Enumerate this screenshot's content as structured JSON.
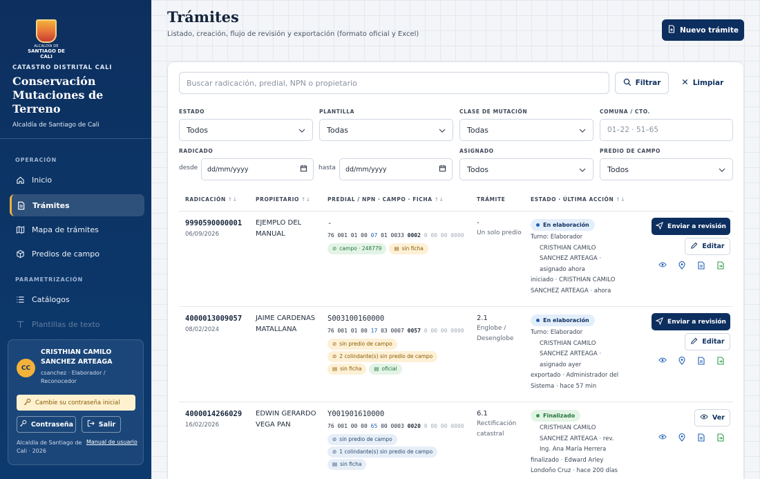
{
  "sidebar": {
    "logo_sub": "ALCALDÍA DE",
    "logo_main": "SANTIAGO DE CALI",
    "kicker": "CATASTRO DISTRITAL CALI",
    "title": "Conservación Mutaciones de Terreno",
    "subtitle": "Alcaldía de Santiago de Cali",
    "section_operacion": "OPERACIÓN",
    "section_param": "PARAMETRIZACIÓN",
    "nav": {
      "inicio": "Inicio",
      "tramites": "Trámites",
      "mapa": "Mapa de trámites",
      "predios": "Predios de campo",
      "catalogos": "Catálogos",
      "plantillas": "Plantillas de texto"
    },
    "user": {
      "initials": "CC",
      "name": "CRISTHIAN CAMILO SANCHEZ ARTEAGA",
      "role": "csanchez · Elaborador / Reconocedor",
      "warn": "Cambie su contraseña inicial",
      "password_btn": "Contraseña",
      "logout_btn": "Salir",
      "footer": "Alcaldía de Santiago de Cali · 2026",
      "manual": "Manual de usuario"
    }
  },
  "header": {
    "title": "Trámites",
    "subtitle": "Listado, creación, flujo de revisión y exportación (formato oficial y Excel)",
    "new_button": "Nuevo trámite"
  },
  "filters": {
    "search_placeholder": "Buscar radicación, predial, NPN o propietario",
    "filter_btn": "Filtrar",
    "clear_btn": "Limpiar",
    "estado_label": "ESTADO",
    "estado_value": "Todos",
    "plantilla_label": "PLANTILLA",
    "plantilla_value": "Todas",
    "clase_label": "CLASE DE MUTACIÓN",
    "clase_value": "Todas",
    "comuna_label": "COMUNA / CTO.",
    "comuna_placeholder": "01–22 · 51–65",
    "radicado_label": "RADICADO",
    "desde": "desde",
    "hasta": "hasta",
    "date_placeholder": "dd/mm/yyyy",
    "asignado_label": "ASIGNADO",
    "asignado_value": "Todos",
    "predio_label": "PREDIO DE CAMPO",
    "predio_value": "Todos"
  },
  "table": {
    "headers": {
      "radicacion": "RADICACIÓN",
      "propietario": "PROPIETARIO",
      "predial": "PREDIAL / NPN · CAMPO · FICHA",
      "tramite": "TRÁMITE",
      "estado": "ESTADO · ÚLTIMA ACCIÓN"
    },
    "rows": [
      {
        "radicacion": "9990590000001",
        "fecha": "06/09/2026",
        "propietario": "EJEMPLO DEL MANUAL",
        "predial": "-",
        "npn_a": "76 001 01 00 ",
        "npn_hl": "07",
        "npn_b": " 01 0033 ",
        "npn_bold": "0002",
        "npn_tail": " 0 00 00 0000",
        "chip1": "campo · 248779",
        "chip2": "sin ficha",
        "tramite_code": "-",
        "tramite_desc": "Un solo predio",
        "estado": "En elaboración",
        "line1": "Turno: Elaborador",
        "line2": "CRISTHIAN CAMILO",
        "line3": "SANCHEZ ARTEAGA ·",
        "line4": "asignado ahora",
        "line5": "iniciado · CRISTHIAN CAMILO",
        "line6": "SANCHEZ ARTEAGA · ahora",
        "action": "Enviar a revisión",
        "edit": "Editar"
      },
      {
        "radicacion": "4000013009057",
        "fecha": "08/02/2024",
        "propietario": "JAIME CARDENAS MATALLANA",
        "predial": "S003100160000",
        "npn_a": "76 001 01 00 ",
        "npn_hl": "17",
        "npn_b": " 03 0007 ",
        "npn_bold": "0057",
        "npn_tail": " 0 00 00 0000",
        "chip1": "sin predio de campo",
        "chip2": "2 colindante(s) sin predio de campo",
        "chip3": "sin ficha",
        "chip4": "oficial",
        "tramite_code": "2.1",
        "tramite_desc": "Englobe / Desenglobe",
        "estado": "En elaboración",
        "line1": "Turno: Elaborador",
        "line2": "CRISTHIAN CAMILO",
        "line3": "SANCHEZ ARTEAGA ·",
        "line4": "asignado ayer",
        "line5": "exportado · Administrador del",
        "line6": "Sistema · hace 57 min",
        "action": "Enviar a revisión",
        "edit": "Editar"
      },
      {
        "radicacion": "4000014266029",
        "fecha": "16/02/2026",
        "propietario": "EDWIN GERARDO VEGA PAN",
        "predial": "Y001901610000",
        "npn_a": "76 001 00 00 ",
        "npn_hl": "65",
        "npn_b": " 00 0003 ",
        "npn_bold": "0020",
        "npn_tail": " 0 00 00 0000",
        "chip1": "sin predio de campo",
        "chip2": "1 colindante(s) sin predio de campo",
        "chip3": "sin ficha",
        "tramite_code": "6.1",
        "tramite_desc": "Rectificación catastral",
        "estado": "Finalizado",
        "line1": "CRISTHIAN CAMILO",
        "line2": "SANCHEZ ARTEAGA · rev.",
        "line3": "Ing. Ana María Herrera",
        "line4": "finalizado · Edward Arley",
        "line5": "Londoño Cruz · hace 200 días",
        "view": "Ver"
      }
    ]
  }
}
